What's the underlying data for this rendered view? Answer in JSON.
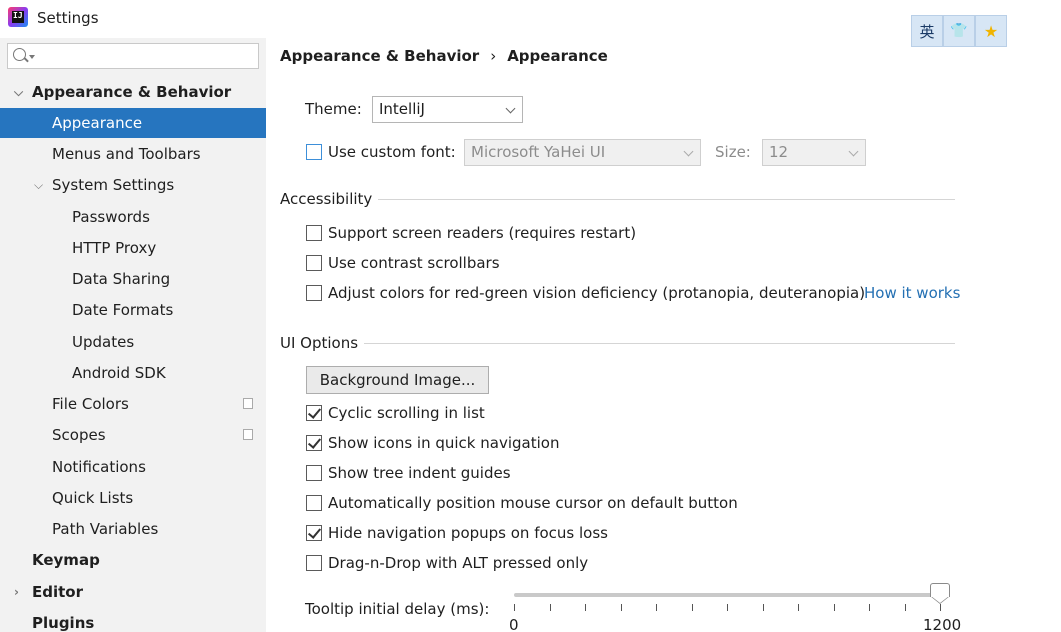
{
  "window": {
    "title": "Settings"
  },
  "ime": {
    "lang": "英",
    "shirt": "👕",
    "star": "★"
  },
  "search": {
    "placeholder": ""
  },
  "sidebar": {
    "items": [
      {
        "label": "Appearance & Behavior",
        "expanded": true
      },
      {
        "label": "Appearance",
        "selected": true
      },
      {
        "label": "Menus and Toolbars"
      },
      {
        "label": "System Settings",
        "expanded": true
      },
      {
        "label": "Passwords"
      },
      {
        "label": "HTTP Proxy"
      },
      {
        "label": "Data Sharing"
      },
      {
        "label": "Date Formats"
      },
      {
        "label": "Updates"
      },
      {
        "label": "Android SDK"
      },
      {
        "label": "File Colors"
      },
      {
        "label": "Scopes"
      },
      {
        "label": "Notifications"
      },
      {
        "label": "Quick Lists"
      },
      {
        "label": "Path Variables"
      },
      {
        "label": "Keymap"
      },
      {
        "label": "Editor",
        "expanded": false
      },
      {
        "label": "Plugins"
      }
    ]
  },
  "breadcrumb": {
    "parent": "Appearance & Behavior",
    "separator": "›",
    "current": "Appearance"
  },
  "theme": {
    "label": "Theme:",
    "value": "IntelliJ"
  },
  "font": {
    "checkbox_label": "Use custom font:",
    "checked": false,
    "value": "Microsoft YaHei UI",
    "size_label": "Size:",
    "size_value": "12"
  },
  "accessibility": {
    "title": "Accessibility",
    "options": [
      {
        "label": "Support screen readers (requires restart)",
        "checked": false
      },
      {
        "label": "Use contrast scrollbars",
        "checked": false
      },
      {
        "label": "Adjust colors for red-green vision deficiency (protanopia, deuteranopia)",
        "checked": false
      }
    ],
    "link": "How it works"
  },
  "ui_options": {
    "title": "UI Options",
    "background_button": "Background Image...",
    "options": [
      {
        "label": "Cyclic scrolling in list",
        "checked": true
      },
      {
        "label": "Show icons in quick navigation",
        "checked": true
      },
      {
        "label": "Show tree indent guides",
        "checked": false
      },
      {
        "label": "Automatically position mouse cursor on default button",
        "checked": false
      },
      {
        "label": "Hide navigation popups on focus loss",
        "checked": true
      },
      {
        "label": "Drag-n-Drop with ALT pressed only",
        "checked": false
      }
    ]
  },
  "tooltip": {
    "label": "Tooltip initial delay (ms):",
    "min": "0",
    "max": "1200",
    "value": 1200
  },
  "colors": {
    "selection": "#2675bf",
    "link": "#2470b3",
    "sidebar_bg": "#f2f2f2"
  }
}
